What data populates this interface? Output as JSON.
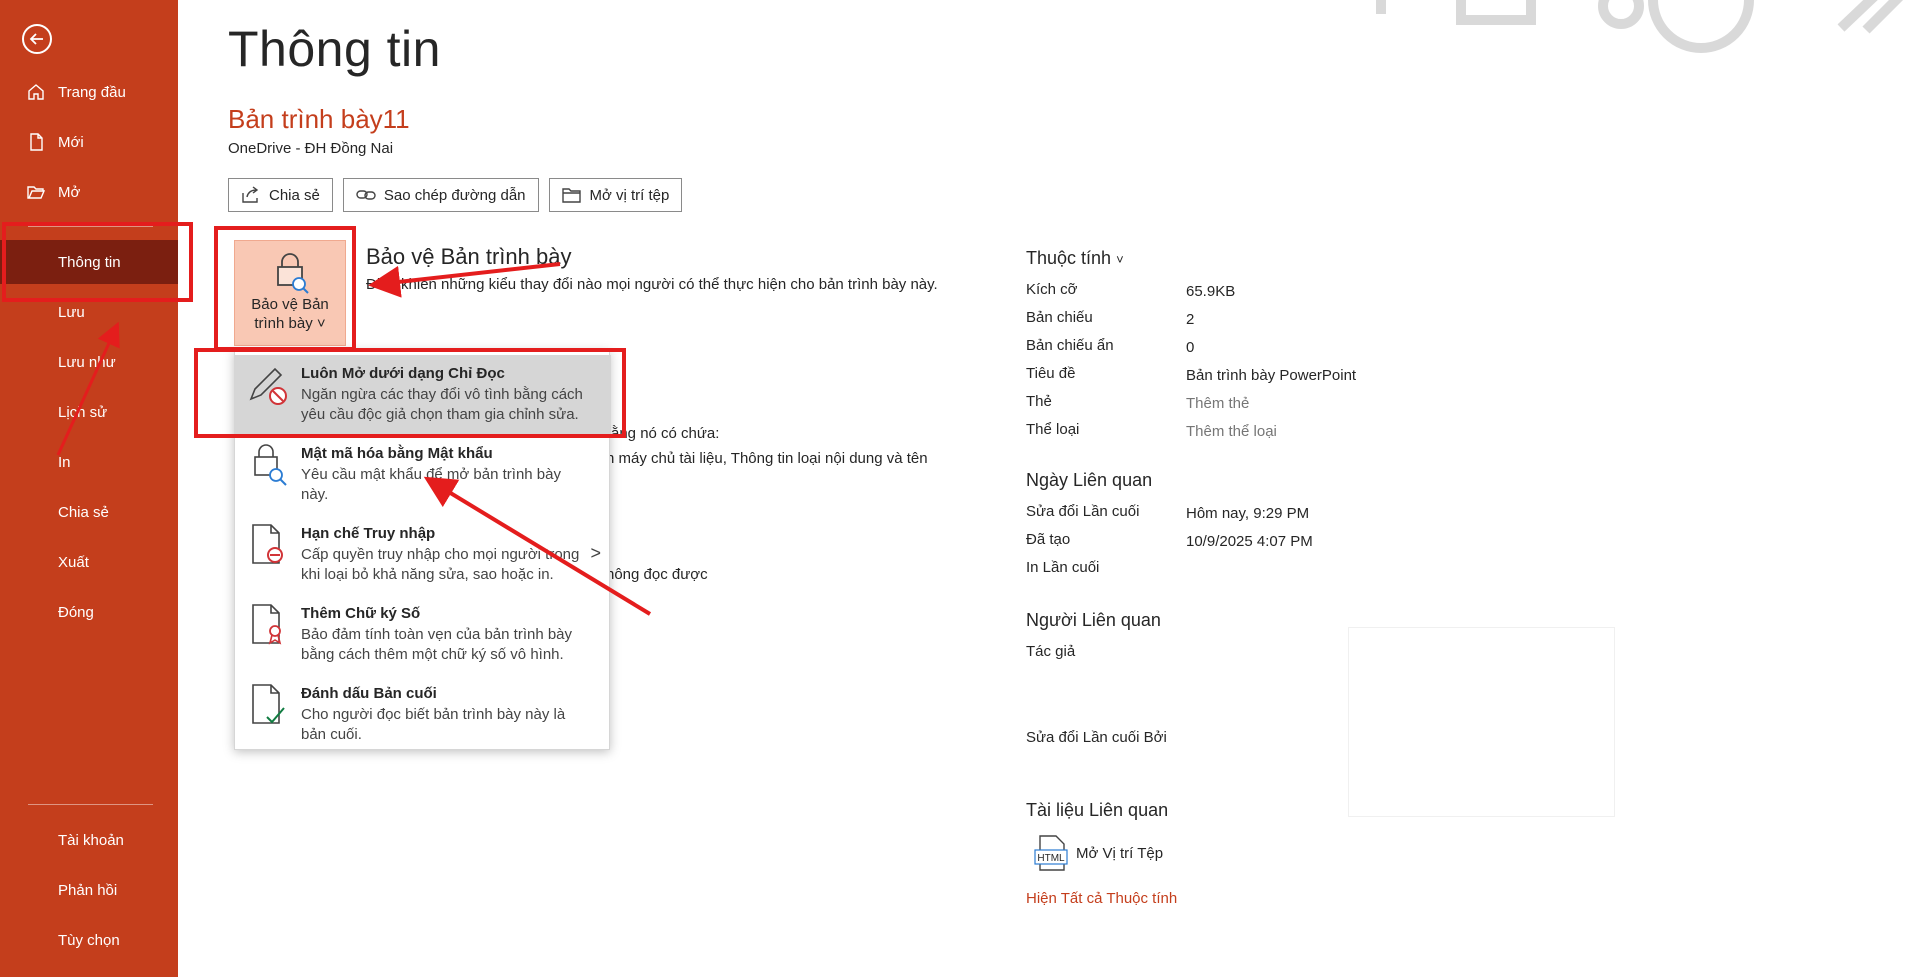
{
  "sidebar": {
    "top_items": [
      {
        "label": "Trang đầu",
        "icon": "home-icon"
      },
      {
        "label": "Mới",
        "icon": "new-document-icon"
      },
      {
        "label": "Mở",
        "icon": "open-folder-icon"
      }
    ],
    "items": [
      {
        "label": "Thông tin"
      },
      {
        "label": "Lưu"
      },
      {
        "label": "Lưu như"
      },
      {
        "label": "Lịch sử"
      },
      {
        "label": "In"
      },
      {
        "label": "Chia sẻ"
      },
      {
        "label": "Xuất"
      },
      {
        "label": "Đóng"
      }
    ],
    "bottom_items": [
      {
        "label": "Tài khoản"
      },
      {
        "label": "Phản hồi"
      },
      {
        "label": "Tùy chọn"
      }
    ],
    "active": "Thông tin",
    "color": "#c43e1c"
  },
  "main": {
    "title": "Thông tin",
    "doc_name": "Bản trình bày11",
    "doc_location": "OneDrive - ĐH Đồng Nai",
    "buttons": [
      {
        "label": "Chia sẻ",
        "icon": "share-icon"
      },
      {
        "label": "Sao chép đường dẫn",
        "icon": "link-icon"
      },
      {
        "label": "Mở vị trí tệp",
        "icon": "folder-icon"
      }
    ],
    "protect": {
      "tile_label_1": "Bảo vệ Bản",
      "tile_label_2": "trình bày",
      "chevron": "˅",
      "title": "Bảo vệ Bản trình bày",
      "description": "Điều khiển những kiểu thay đổi nào mọi người có thể thực hiện cho bản trình bày này."
    },
    "partial_texts": [
      "rằng nó có chứa:",
      "n máy chủ tài liệu, Thông tin loại nội dung và tên",
      "hông đọc được"
    ]
  },
  "menu": {
    "items": [
      {
        "title": "Luôn Mở dưới dạng Chỉ Đọc",
        "desc": "Ngăn ngừa các thay đổi vô tình bằng cách yêu cầu độc giả chọn tham gia chỉnh sửa.",
        "icon": "pencil-no-edit-icon",
        "highlighted": true
      },
      {
        "title": "Mật mã hóa bằng Mật khẩu",
        "desc": "Yêu cầu mật khẩu để mở bản trình bày này.",
        "icon": "lock-key-icon"
      },
      {
        "title": "Hạn chế Truy nhập",
        "desc": "Cấp quyền truy nhập cho mọi người trong khi loại bỏ khả năng sửa, sao hoặc in.",
        "icon": "restrict-document-icon",
        "submenu": ">"
      },
      {
        "title": "Thêm Chữ ký Số",
        "desc": "Bảo đảm tính toàn vẹn của bản trình bày bằng cách thêm một chữ ký số vô hình.",
        "icon": "signature-ribbon-icon"
      },
      {
        "title": "Đánh dấu Bản cuối",
        "desc": "Cho người đọc biết bản trình bày này là bản cuối.",
        "icon": "document-check-icon"
      }
    ]
  },
  "properties": {
    "header": "Thuộc tính",
    "chevron": "˅",
    "rows": [
      {
        "key": "Kích cỡ",
        "value": "65.9KB"
      },
      {
        "key": "Bản chiếu",
        "value": "2"
      },
      {
        "key": "Bản chiếu ẩn",
        "value": "0"
      },
      {
        "key": "Tiêu đề",
        "value": "Bản trình bày PowerPoint"
      },
      {
        "key": "Thẻ",
        "value": "Thêm thẻ"
      },
      {
        "key": "Thể loại",
        "value": "Thêm thể loại"
      }
    ],
    "related_dates": {
      "header": "Ngày Liên quan",
      "rows": [
        {
          "key": "Sửa đổi Lần cuối",
          "value": "Hôm nay, 9:29 PM"
        },
        {
          "key": "Đã tạo",
          "value": "10/9/2025 4:07 PM"
        },
        {
          "key": "In Lần cuối",
          "value": ""
        }
      ]
    },
    "related_people": {
      "header": "Người Liên quan",
      "author_label": "Tác giả",
      "modified_by_label": "Sửa đổi Lần cuối Bởi"
    },
    "related_docs": {
      "header": "Tài liệu Liên quan",
      "open_location": "Mở Vị trí Tệp",
      "html_badge": "HTML"
    },
    "show_all": "Hiện Tất cả Thuộc tính"
  },
  "annotation_color": "#e41d1d"
}
